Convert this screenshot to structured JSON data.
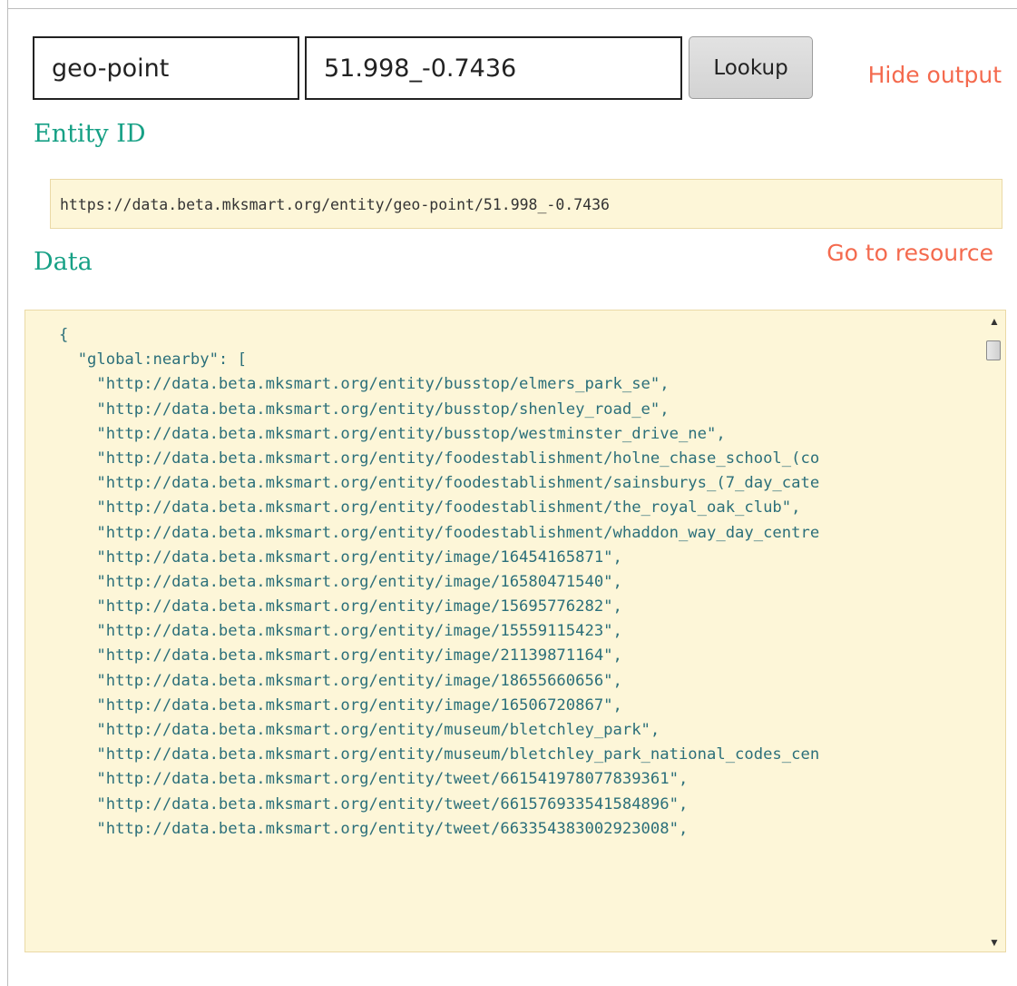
{
  "lookup": {
    "type_value": "geo-point",
    "id_value": "51.998_-0.7436",
    "button_label": "Lookup",
    "hide_output_label": "Hide output"
  },
  "entity": {
    "heading": "Entity ID",
    "uri": "https://data.beta.mksmart.org/entity/geo-point/51.998_-0.7436"
  },
  "data_section": {
    "heading": "Data",
    "go_to_resource_label": "Go to resource",
    "json_lines": [
      "{",
      "  \"global:nearby\": [",
      "    \"http://data.beta.mksmart.org/entity/busstop/elmers_park_se\",",
      "    \"http://data.beta.mksmart.org/entity/busstop/shenley_road_e\",",
      "    \"http://data.beta.mksmart.org/entity/busstop/westminster_drive_ne\",",
      "    \"http://data.beta.mksmart.org/entity/foodestablishment/holne_chase_school_(co",
      "    \"http://data.beta.mksmart.org/entity/foodestablishment/sainsburys_(7_day_cate",
      "    \"http://data.beta.mksmart.org/entity/foodestablishment/the_royal_oak_club\",",
      "    \"http://data.beta.mksmart.org/entity/foodestablishment/whaddon_way_day_centre",
      "    \"http://data.beta.mksmart.org/entity/image/16454165871\",",
      "    \"http://data.beta.mksmart.org/entity/image/16580471540\",",
      "    \"http://data.beta.mksmart.org/entity/image/15695776282\",",
      "    \"http://data.beta.mksmart.org/entity/image/15559115423\",",
      "    \"http://data.beta.mksmart.org/entity/image/21139871164\",",
      "    \"http://data.beta.mksmart.org/entity/image/18655660656\",",
      "    \"http://data.beta.mksmart.org/entity/image/16506720867\",",
      "    \"http://data.beta.mksmart.org/entity/museum/bletchley_park\",",
      "    \"http://data.beta.mksmart.org/entity/museum/bletchley_park_national_codes_cen",
      "    \"http://data.beta.mksmart.org/entity/tweet/661541978077839361\",",
      "    \"http://data.beta.mksmart.org/entity/tweet/661576933541584896\",",
      "    \"http://data.beta.mksmart.org/entity/tweet/663354383002923008\","
    ]
  },
  "icons": {
    "scroll_up": "▲",
    "scroll_down": "▼"
  }
}
